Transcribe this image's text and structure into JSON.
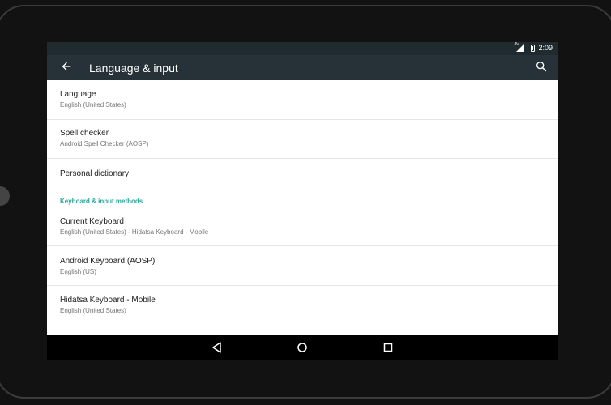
{
  "status": {
    "signal_label": "3G",
    "time": "2:09"
  },
  "appbar": {
    "title": "Language & input"
  },
  "items": [
    {
      "title": "Language",
      "subtitle": "English (United States)"
    },
    {
      "title": "Spell checker",
      "subtitle": "Android Spell Checker (AOSP)"
    },
    {
      "title": "Personal dictionary",
      "subtitle": ""
    },
    {
      "title": "Current Keyboard",
      "subtitle": "English (United States) - Hidatsa Keyboard - Mobile"
    },
    {
      "title": "Android Keyboard (AOSP)",
      "subtitle": "English (US)"
    },
    {
      "title": "Hidatsa Keyboard - Mobile",
      "subtitle": "English (United States)"
    }
  ],
  "section": {
    "label": "Keyboard & input methods"
  },
  "icons": {
    "back": "arrow-left-icon",
    "search": "search-icon",
    "nav_back": "triangle-back-icon",
    "nav_home": "circle-home-icon",
    "nav_recents": "square-recents-icon"
  },
  "colors": {
    "appbar": "#263238",
    "statusbar": "#1f2b2f",
    "accent": "#26a69a",
    "navbar": "#000000"
  }
}
